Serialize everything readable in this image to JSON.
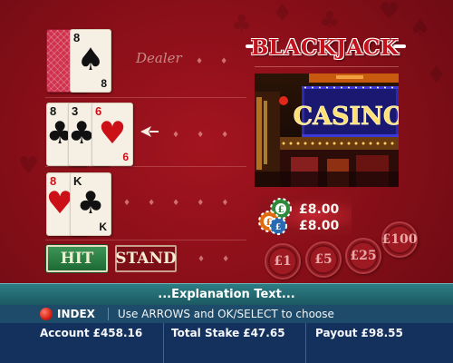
{
  "colors": {
    "background": "#8a0f19",
    "hit_button": "#2e7d44",
    "explanation_bar": "#236a72",
    "index_bar": "#1f4b6a",
    "account_bar": "#13315c"
  },
  "dealer": {
    "label": "Dealer",
    "cards": [
      {
        "face": "back"
      },
      {
        "rank": "8",
        "suit": "spades",
        "glyph": "♠",
        "color": "black"
      }
    ]
  },
  "player_hand_1": {
    "active": true,
    "cards": [
      {
        "rank": "8",
        "suit": "clubs",
        "glyph": "♣",
        "color": "black"
      },
      {
        "rank": "3",
        "suit": "clubs",
        "glyph": "♣",
        "color": "black"
      },
      {
        "rank": "6",
        "suit": "hearts",
        "glyph": "♥",
        "color": "red"
      }
    ]
  },
  "player_hand_2": {
    "cards": [
      {
        "rank": "8",
        "suit": "hearts",
        "glyph": "♥",
        "color": "red"
      },
      {
        "rank": "K",
        "suit": "clubs",
        "glyph": "♣",
        "color": "black"
      }
    ]
  },
  "buttons": {
    "hit": "HIT",
    "stand": "STAND"
  },
  "logo": {
    "text": "BLACKJACK"
  },
  "photo": {
    "sign_text": "CASINO"
  },
  "stakes": {
    "hand_1": "£8.00",
    "hand_2": "£8.00"
  },
  "chips": [
    {
      "label": "£1"
    },
    {
      "label": "£5"
    },
    {
      "label": "£25"
    },
    {
      "label": "£100"
    }
  ],
  "explanation": "...Explanation Text...",
  "index_bar": {
    "button_label": "INDEX",
    "help_text": "Use ARROWS and OK/SELECT to choose"
  },
  "account_bar": {
    "account_label": "Account",
    "account_value": "£458.16",
    "stake_label": "Total Stake",
    "stake_value": "£47.65",
    "payout_label": "Payout",
    "payout_value": "£98.55"
  }
}
